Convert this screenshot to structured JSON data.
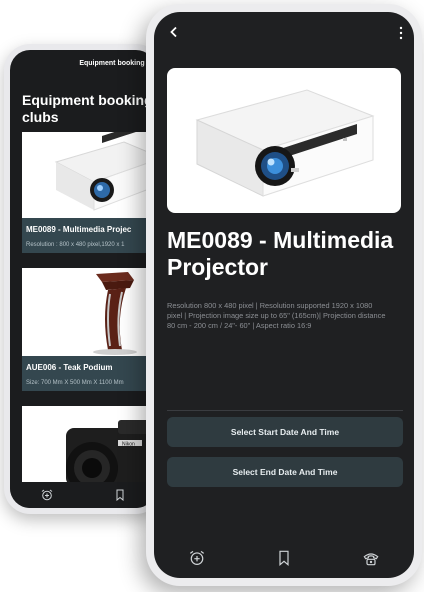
{
  "back_screen": {
    "app_bar_title": "Equipment booking",
    "page_title_line1": "Equipment booking fo",
    "page_title_line2": "clubs",
    "items": [
      {
        "name": "ME0089 - Multimedia Projec",
        "detail": "Resolution : 800 x 480 pixel,1920 x 1"
      },
      {
        "name": "AUE006 - Teak Podium",
        "detail": "Size: 700 Mm X 500 Mm X 1100 Mm"
      },
      {
        "name": "",
        "detail": ""
      }
    ],
    "nav": [
      {
        "icon": "alarm-add-icon"
      },
      {
        "icon": "bookmark-icon"
      }
    ]
  },
  "front_screen": {
    "title": "ME0089 - Multimedia Projector",
    "description": "Resolution 800 x 480 pixel | Resolution supported 1920 x 1080 pixel | Projection image size up to 65\" (165cm)|  Projection distance 80 cm - 200 cm / 24\"- 60\" | Aspect ratio 16:9",
    "buttons": {
      "start": "Select Start Date And Time",
      "end": "Select End Date And Time"
    },
    "nav": [
      {
        "icon": "alarm-add-icon"
      },
      {
        "icon": "bookmark-icon"
      },
      {
        "icon": "phone-icon"
      }
    ]
  },
  "colors": {
    "screen_bg": "#1f2022",
    "card_caption": "#34474f",
    "button_bg": "#2f3b40"
  }
}
